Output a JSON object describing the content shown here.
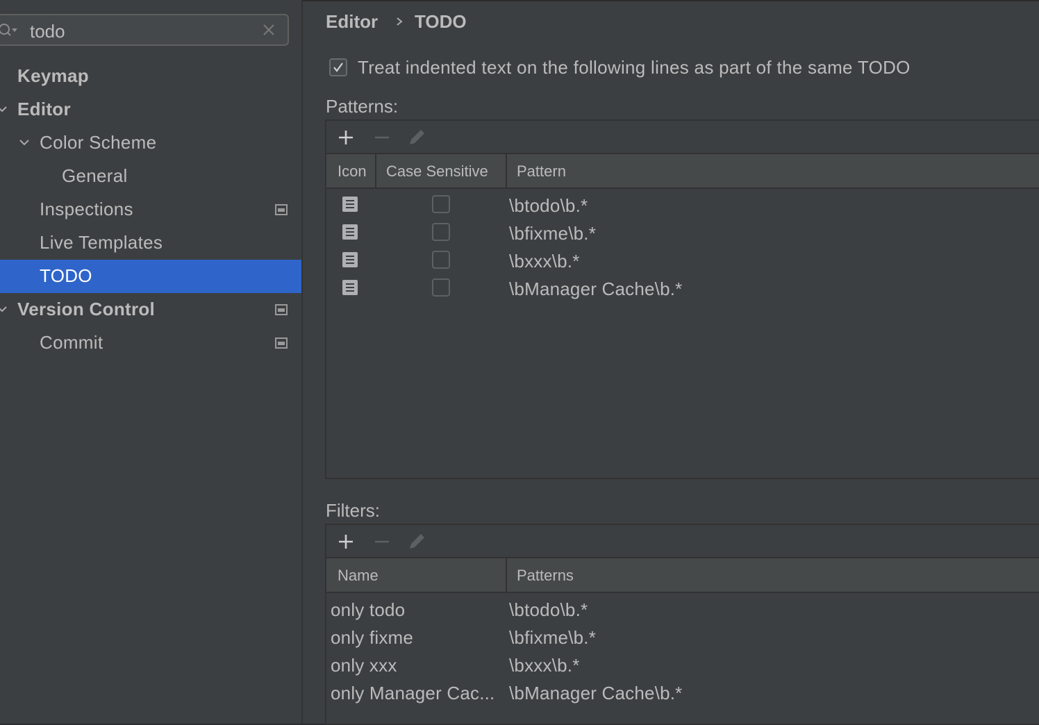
{
  "search": {
    "value": "todo",
    "search_icon": "search-icon",
    "clear_icon": "close-icon"
  },
  "sidebar": {
    "items": [
      {
        "label": "Keymap"
      },
      {
        "label": "Editor"
      },
      {
        "label": "Color Scheme"
      },
      {
        "label": "General"
      },
      {
        "label": "Inspections"
      },
      {
        "label": "Live Templates"
      },
      {
        "label": "TODO"
      },
      {
        "label": "Version Control"
      },
      {
        "label": "Commit"
      }
    ],
    "selected": "TODO"
  },
  "breadcrumb": {
    "parent": "Editor",
    "current": "TODO"
  },
  "treat_indented": {
    "checked": true,
    "label": "Treat indented text on the following lines as part of the same TODO"
  },
  "patterns": {
    "label": "Patterns:",
    "columns": [
      "Icon",
      "Case Sensitive",
      "Pattern"
    ],
    "rows": [
      {
        "icon": "document-icon",
        "case_sensitive": false,
        "pattern": "\\btodo\\b.*"
      },
      {
        "icon": "document-icon",
        "case_sensitive": false,
        "pattern": "\\bfixme\\b.*"
      },
      {
        "icon": "document-icon",
        "case_sensitive": false,
        "pattern": "\\bxxx\\b.*"
      },
      {
        "icon": "document-icon",
        "case_sensitive": false,
        "pattern": "\\bManager Cache\\b.*"
      }
    ]
  },
  "filters": {
    "label": "Filters:",
    "columns": [
      "Name",
      "Patterns"
    ],
    "rows": [
      {
        "name": "only todo",
        "patterns": "\\btodo\\b.*"
      },
      {
        "name": "only fixme",
        "patterns": "\\bfixme\\b.*"
      },
      {
        "name": "only xxx",
        "patterns": "\\bxxx\\b.*"
      },
      {
        "name": "only Manager Cac...",
        "patterns": "\\bManager Cache\\b.*"
      }
    ]
  },
  "colors": {
    "selection": "#2f65ca",
    "sidebar_bg": "#3c3f41",
    "text": "#bbbbbb"
  }
}
